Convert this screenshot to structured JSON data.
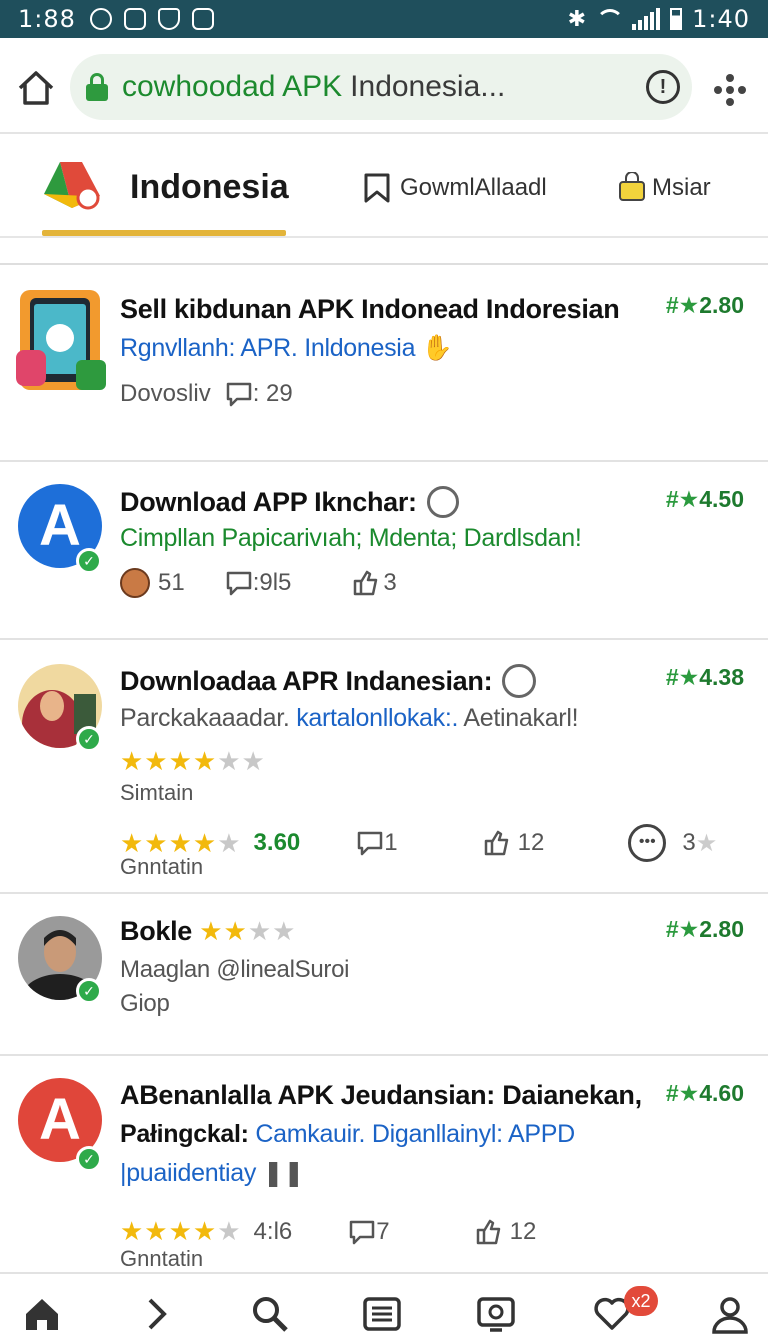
{
  "status_bar": {
    "time": "1:88",
    "clock_right": "1:40"
  },
  "address_bar": {
    "url_highlight": "cowhoodad APK",
    "url_rest": "Indonesia..."
  },
  "tabs": [
    {
      "label": "Indonesia"
    },
    {
      "label": "GowmlAllaadl"
    },
    {
      "label": "Msiar"
    }
  ],
  "apps": [
    {
      "title": "Sell kibdunan APK Indonead Indoresian",
      "subtitle": "Rgnvllanh: APR. Inldonesia",
      "meta_text": "Dovosliv",
      "comments": ": 29",
      "rating": "2.80"
    },
    {
      "title": "Download APP Iknchar:",
      "subtitle": "Cimpllan Papicarivıah; Mdenta; Dardlsdan!",
      "user_count": "51",
      "comments": ":9l5",
      "likes": "3",
      "rating": "4.50"
    },
    {
      "title": "Downloadaa APR Indanesian:",
      "subtitle_grey": "Parckakaaadar.",
      "subtitle_blue": "kartalonllokak:.",
      "subtitle_tail": "Aetinakarl!",
      "label_a": "Simtain",
      "score": "3.60",
      "comments": "1",
      "likes": "12",
      "extra": "3",
      "label_b": "Gnntatin",
      "rating": "4.38"
    },
    {
      "title": "Bokle",
      "line1": "Maaglan @linealSuroi",
      "line2": "Giop",
      "rating": "2.80"
    },
    {
      "title": "ABenanlalla APK Jeudansian: Daianekan,",
      "line2_black": "Pałingckal:",
      "line2_blue": "Camkauir. Diganllainyl: APPD",
      "line3": "|puaiidentiay",
      "score": "4:l6",
      "comments": "7",
      "likes": "12",
      "label": "Gnntatin",
      "rating": "4.60"
    }
  ],
  "bottom_nav": {
    "badge": "x2"
  }
}
